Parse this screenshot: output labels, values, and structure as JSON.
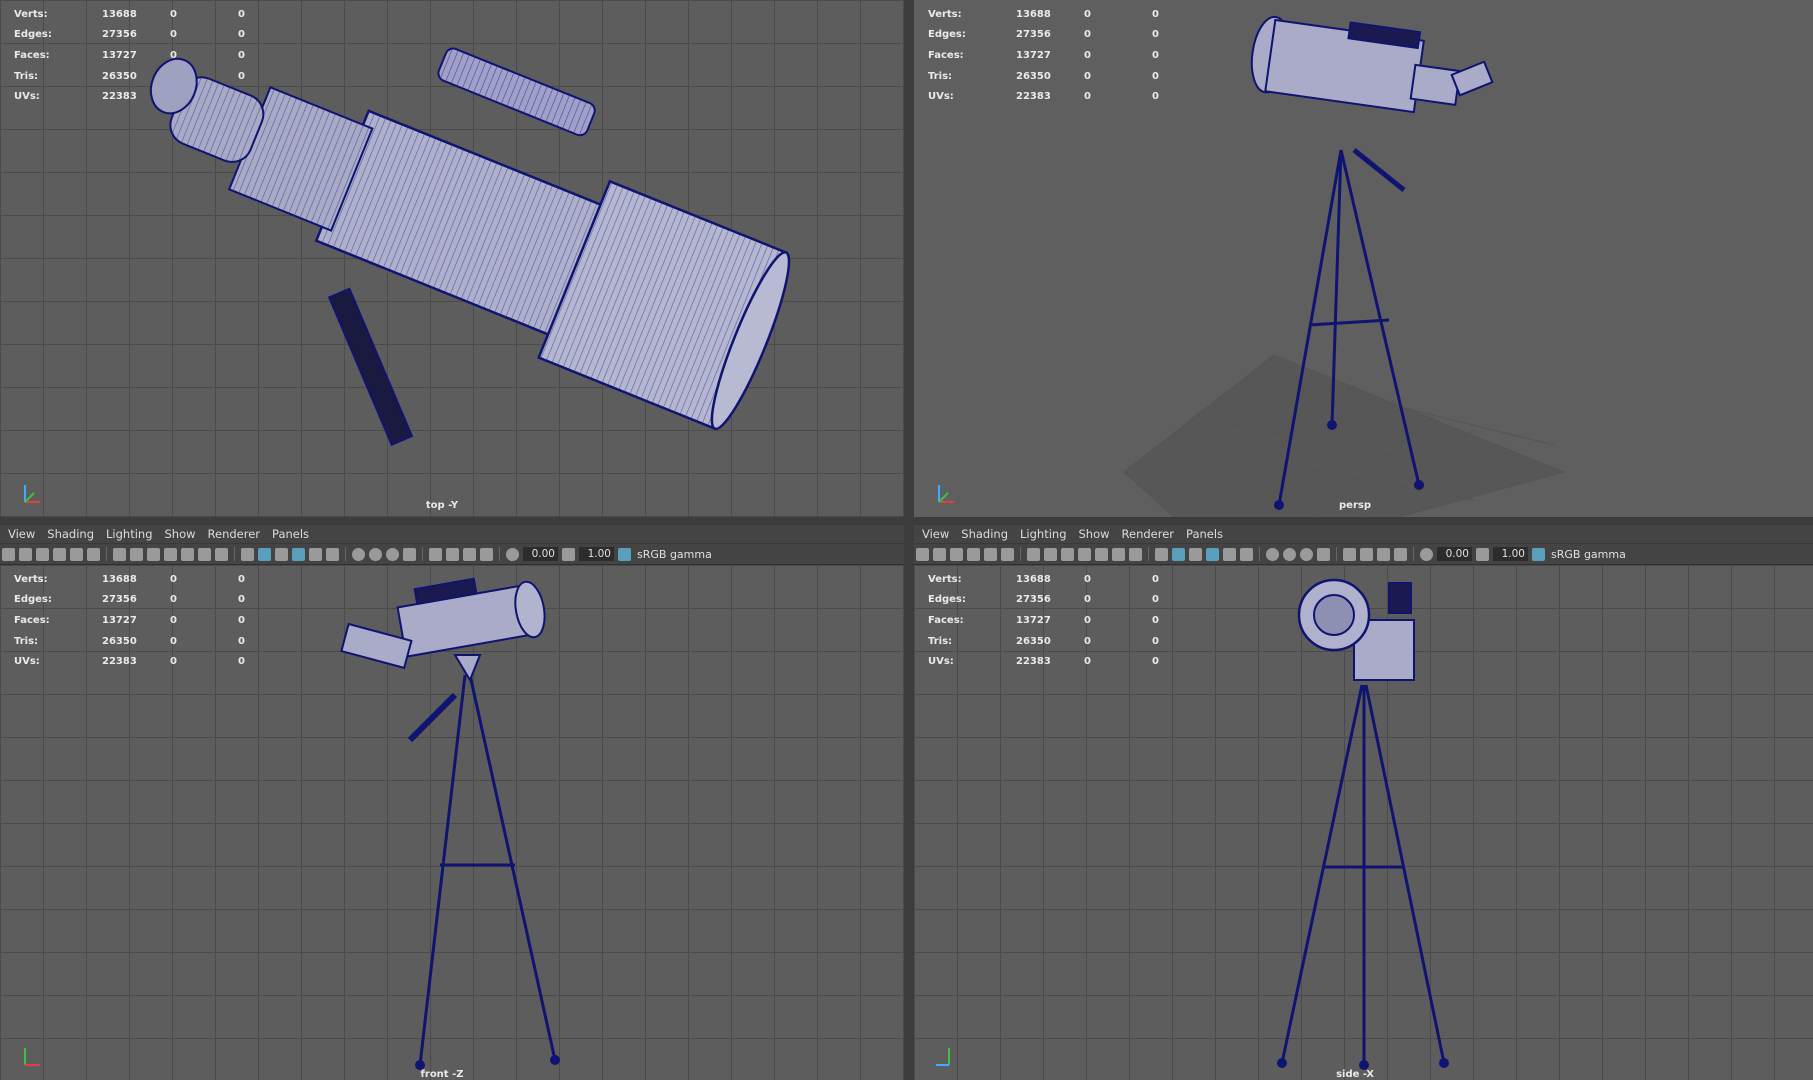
{
  "stats": {
    "rows": [
      {
        "label": "Verts:",
        "v1": "13688",
        "v2": "0",
        "v3": "0"
      },
      {
        "label": "Edges:",
        "v1": "27356",
        "v2": "0",
        "v3": "0"
      },
      {
        "label": "Faces:",
        "v1": "13727",
        "v2": "0",
        "v3": "0"
      },
      {
        "label": "Tris:",
        "v1": "26350",
        "v2": "0",
        "v3": "0"
      },
      {
        "label": "UVs:",
        "v1": "22383",
        "v2": "0",
        "v3": "0"
      }
    ]
  },
  "viewports": {
    "top": {
      "camera": "top -Y"
    },
    "persp": {
      "camera": "persp"
    },
    "front": {
      "camera": "front -Z"
    },
    "side": {
      "camera": "side -X"
    }
  },
  "menu": {
    "view": "View",
    "shading": "Shading",
    "lighting": "Lighting",
    "show": "Show",
    "renderer": "Renderer",
    "panels": "Panels"
  },
  "toolbar": {
    "exposure": "0.00",
    "gamma": "1.00",
    "colorspace": "sRGB gamma"
  },
  "colors": {
    "wire": "#0f1470",
    "active_icon": "#5b9fbf",
    "viewport_bg": "#5d5d5d"
  }
}
